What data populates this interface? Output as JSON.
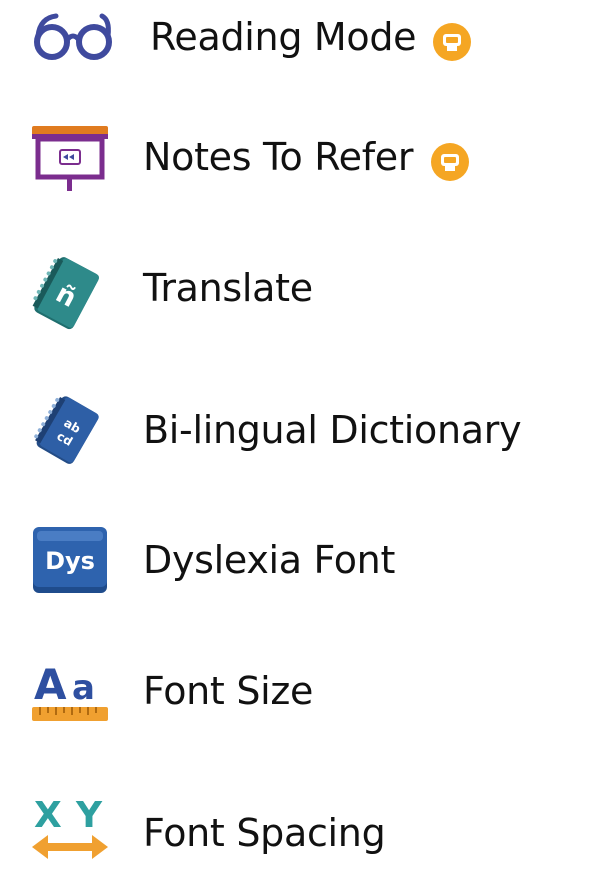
{
  "menu": {
    "items": [
      {
        "label": "Reading Mode",
        "icon": "glasses-icon",
        "badge": "premium-badge-icon"
      },
      {
        "label": "Notes To Refer",
        "icon": "presentation-board-icon",
        "badge": "premium-badge-icon"
      },
      {
        "label": "Translate",
        "icon": "translate-book-icon"
      },
      {
        "label": "Bi-lingual Dictionary",
        "icon": "dictionary-book-icon"
      },
      {
        "label": "Dyslexia Font",
        "icon": "dyslexia-font-icon"
      },
      {
        "label": "Font Size",
        "icon": "font-size-icon"
      },
      {
        "label": "Font Spacing",
        "icon": "font-spacing-icon"
      }
    ]
  },
  "colors": {
    "badge": "#F5A623",
    "glasses": "#3F4A9E",
    "board_frame": "#7B2D8E",
    "board_top": "#E07B1F",
    "book_teal": "#2E8A8A",
    "book_blue": "#2E5FA6",
    "dys_blue": "#2E63AE",
    "font_size_blue": "#2E4FA0",
    "ruler_orange": "#F0A030",
    "font_spacing_teal": "#2EA0A0"
  }
}
